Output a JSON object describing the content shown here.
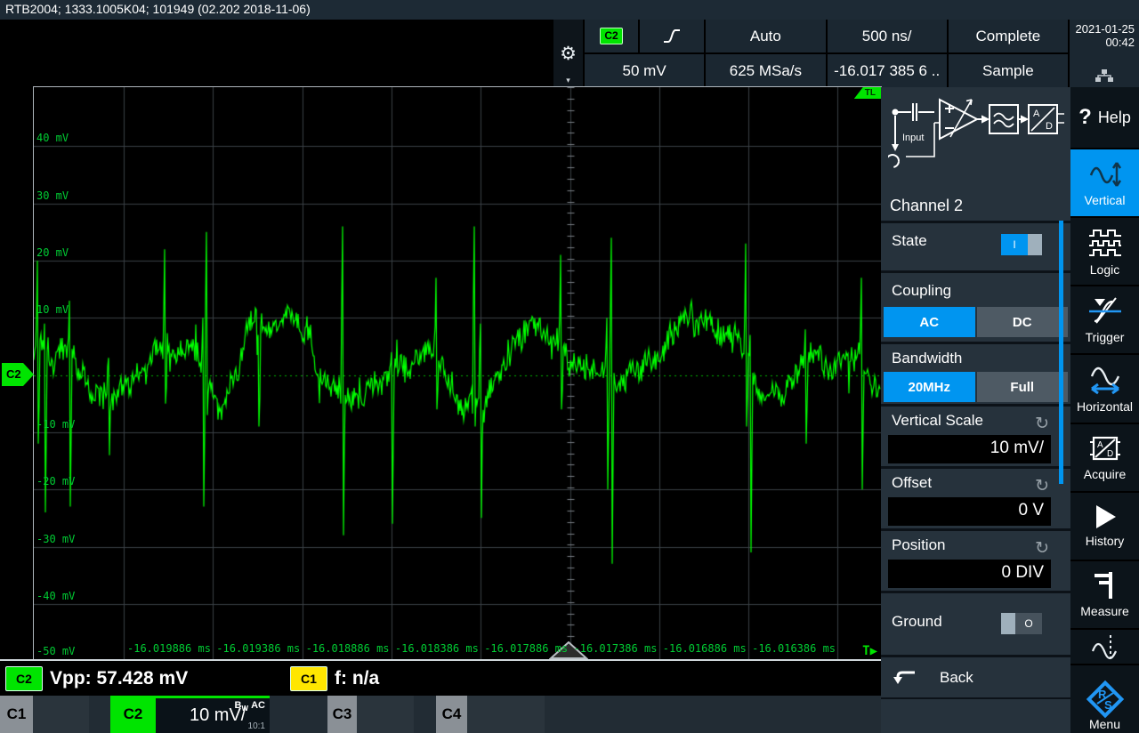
{
  "title_bar": {
    "text": "RTB2004; 1333.1005K04; 101949 (02.202 2018-11-06)"
  },
  "toolbar": {
    "channel_badge": "C2",
    "scale": "50 mV",
    "trigger_mode": "Auto",
    "sample_rate": "625 MSa/s",
    "timebase": "500 ns/",
    "trigger_offset": "-16.017 385 6 ..",
    "acquisition_status": "Complete",
    "acquisition_mode": "Sample",
    "date": "2021-01-25",
    "time": "00:42"
  },
  "graph": {
    "y_labels": [
      "40 mV",
      "30 mV",
      "20 mV",
      "10 mV",
      "-10 mV",
      "-20 mV",
      "-30 mV",
      "-40 mV",
      "-50 mV"
    ],
    "x_labels": [
      "-16.019886 ms",
      "-16.019386 ms",
      "-16.018886 ms",
      "-16.018386 ms",
      "-16.017886 ms",
      "-16.017386 ms",
      "-16.016886 ms",
      "-16.016386 ms"
    ],
    "channel_marker": "C2",
    "trigger_level_marker": "TL",
    "trigger_indicator": "T▶",
    "colors": {
      "trace": "#00ff00",
      "grid": "#3a4046",
      "label": "#00cc33",
      "zero_line": "#00b400"
    }
  },
  "waveform": {
    "seed": 1337,
    "noise_amp": 1.9,
    "wander": 2.0,
    "mv_per_div": 10,
    "mounds": [
      [
        8,
        10,
        6
      ],
      [
        35,
        12,
        6
      ],
      [
        118,
        16,
        5
      ],
      [
        145,
        10,
        6
      ],
      [
        258,
        20,
        6
      ],
      [
        292,
        12,
        8
      ],
      [
        420,
        18,
        6
      ],
      [
        452,
        10,
        7
      ],
      [
        560,
        22,
        6
      ],
      [
        592,
        10,
        6
      ],
      [
        680,
        25,
        5
      ],
      [
        745,
        30,
        8
      ],
      [
        790,
        14,
        8
      ],
      [
        878,
        20,
        6
      ],
      [
        922,
        12,
        7
      ],
      [
        95,
        15,
        -5
      ],
      [
        215,
        12,
        -5
      ],
      [
        505,
        15,
        -4
      ],
      [
        655,
        12,
        -4
      ]
    ],
    "spikes": [
      [
        4,
        20,
        -12
      ],
      [
        12,
        9,
        -24
      ],
      [
        40,
        13,
        -23
      ],
      [
        84,
        3,
        -14
      ],
      [
        147,
        22,
        -5
      ],
      [
        190,
        10,
        -23
      ],
      [
        194,
        25,
        -7
      ],
      [
        252,
        7,
        -9
      ],
      [
        347,
        26,
        -28
      ],
      [
        402,
        4,
        -26
      ],
      [
        452,
        17,
        -6
      ],
      [
        495,
        26,
        -9
      ],
      [
        502,
        9,
        -25
      ],
      [
        592,
        21,
        -6
      ],
      [
        644,
        10,
        -20
      ],
      [
        649,
        24,
        -33
      ],
      [
        800,
        23,
        -9
      ],
      [
        805,
        7,
        -31
      ],
      [
        867,
        8,
        -12
      ],
      [
        930,
        17,
        -20
      ]
    ]
  },
  "side_panel": {
    "title": "Channel 2",
    "diagram_input_label": "Input",
    "state": {
      "label": "State",
      "value": "I"
    },
    "coupling": {
      "label": "Coupling",
      "options": [
        "AC",
        "DC"
      ],
      "selected": "AC"
    },
    "bandwidth": {
      "label": "Bandwidth",
      "options": [
        "20MHz",
        "Full"
      ],
      "selected": "20MHz"
    },
    "vertical_scale": {
      "label": "Vertical Scale",
      "value": "10 mV/"
    },
    "offset": {
      "label": "Offset",
      "value": "0 V"
    },
    "position": {
      "label": "Position",
      "value": "0 DIV"
    },
    "ground": {
      "label": "Ground",
      "value": "O"
    },
    "back_label": "Back"
  },
  "sidebar": {
    "help_icon": "?",
    "items": [
      {
        "label": "Help"
      },
      {
        "label": "Vertical",
        "active": true
      },
      {
        "label": "Logic"
      },
      {
        "label": "Trigger"
      },
      {
        "label": "Horizontal"
      },
      {
        "label": "Acquire"
      },
      {
        "label": "History"
      },
      {
        "label": "Measure"
      },
      {
        "label": "Menu"
      }
    ]
  },
  "measurement_bar": {
    "items": [
      {
        "channel": "C2",
        "badge_color": "#00e400",
        "text": "Vpp: 57.428 mV"
      },
      {
        "channel": "C1",
        "badge_color": "#ffe600",
        "text": "f: n/a"
      }
    ]
  },
  "channel_bar": {
    "tabs": [
      {
        "label": "C1"
      },
      {
        "label": "C2",
        "scale": "10 mV/",
        "bw_prefix": "B",
        "bw_sub": "W",
        "coupling": "AC",
        "probe": "10:1",
        "active": true
      },
      {
        "label": "C3"
      },
      {
        "label": "C4"
      }
    ]
  }
}
